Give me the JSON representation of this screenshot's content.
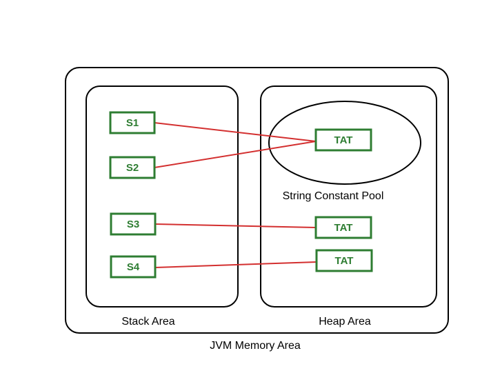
{
  "diagram": {
    "title": "JVM Memory Area",
    "left_area": {
      "label": "Stack Area",
      "items": [
        "S1",
        "S2",
        "S3",
        "S4"
      ]
    },
    "right_area": {
      "label": "Heap Area",
      "pool_label": "String Constant Pool",
      "items": [
        "TAT",
        "TAT",
        "TAT"
      ]
    }
  }
}
